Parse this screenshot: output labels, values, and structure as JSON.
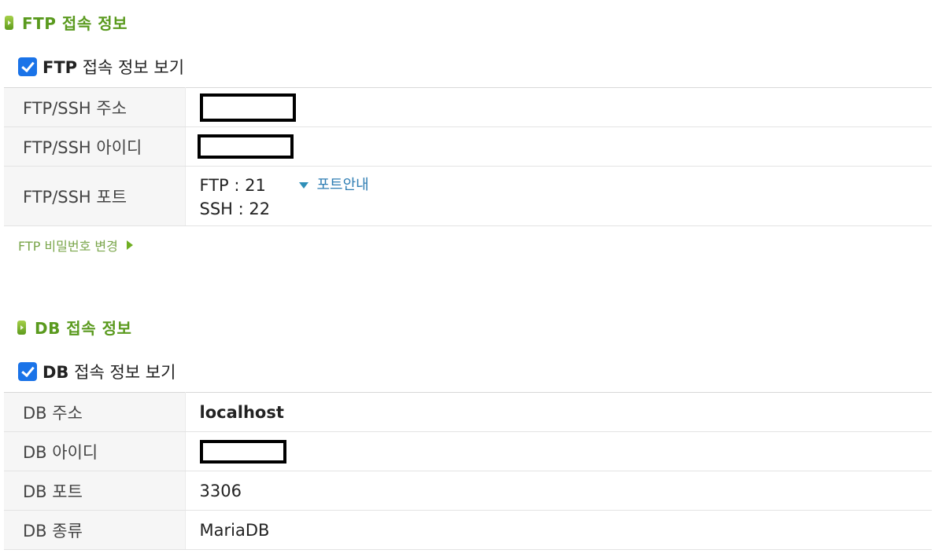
{
  "ftp": {
    "title": "FTP 접속 정보",
    "checkbox_bold": "FTP",
    "checkbox_rest": " 접속 정보 보기",
    "rows": {
      "address_label": "FTP/SSH 주소",
      "id_label": "FTP/SSH 아이디",
      "port_label": "FTP/SSH 포트",
      "port_ftp": "FTP : 21",
      "port_ssh": "SSH : 22",
      "port_guide": "포트안내"
    },
    "password_link": "FTP 비밀번호 변경"
  },
  "db": {
    "title": "DB 접속 정보",
    "checkbox_bold": "DB",
    "checkbox_rest": " 접속 정보 보기",
    "rows": {
      "address_label": "DB 주소",
      "address_value": "localhost",
      "id_label": "DB 아이디",
      "port_label": "DB 포트",
      "port_value": "3306",
      "type_label": "DB 종류",
      "type_value": "MariaDB"
    }
  },
  "colors": {
    "section_title": "#5a9a1e",
    "checkbox": "#1a73e8",
    "guide_link": "#2e7db3",
    "password_link": "#79a54a"
  },
  "icons": [
    "section-bullet-icon",
    "checkmark-icon",
    "triangle-down-icon",
    "triangle-right-icon"
  ]
}
